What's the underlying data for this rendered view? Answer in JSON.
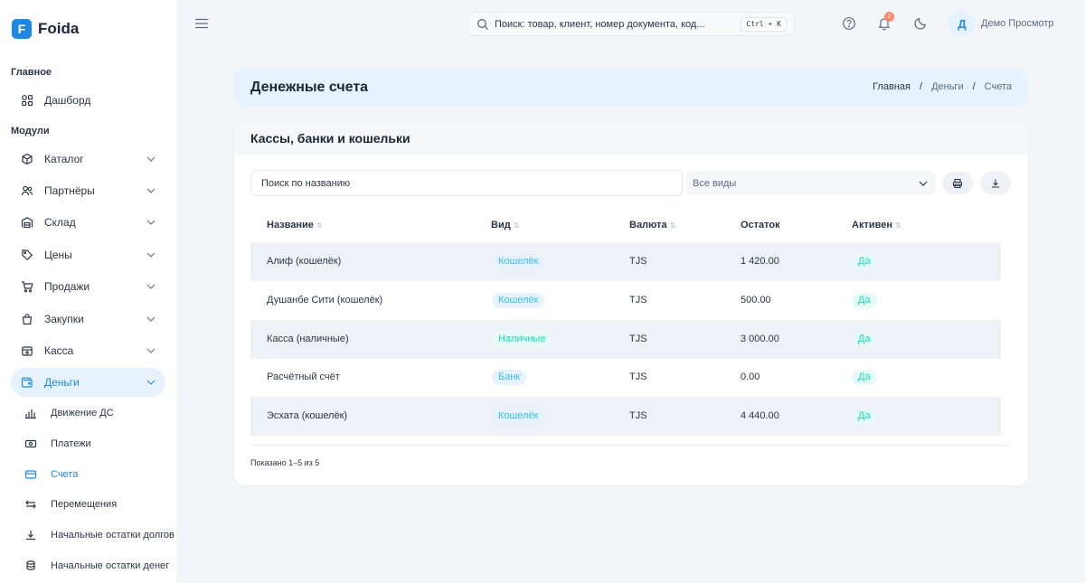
{
  "app": {
    "logo_letter": "F",
    "name": "Foida",
    "brand_color": "#1e88e5"
  },
  "sidebar": {
    "section_main": "Главное",
    "dashboard": "Дашборд",
    "section_modules": "Модули",
    "modules": [
      {
        "label": "Каталог",
        "icon": "box-icon"
      },
      {
        "label": "Партнёры",
        "icon": "users-icon"
      },
      {
        "label": "Склад",
        "icon": "warehouse-icon"
      },
      {
        "label": "Цены",
        "icon": "tag-icon"
      },
      {
        "label": "Продажи",
        "icon": "cart-icon"
      },
      {
        "label": "Закупки",
        "icon": "bag-icon"
      },
      {
        "label": "Касса",
        "icon": "cashbox-icon"
      },
      {
        "label": "Деньги",
        "icon": "wallet-icon"
      }
    ],
    "money_sub": [
      {
        "label": "Движение ДС",
        "icon": "chart-bars-icon"
      },
      {
        "label": "Платежи",
        "icon": "cash-icon"
      },
      {
        "label": "Счета",
        "icon": "card-icon"
      },
      {
        "label": "Перемещения",
        "icon": "transfer-icon"
      },
      {
        "label": "Начальные остатки долгов",
        "icon": "download-icon"
      },
      {
        "label": "Начальные остатки денег",
        "icon": "coins-icon"
      }
    ]
  },
  "topbar": {
    "search_placeholder": "Поиск: товар, клиент, номер документа, код...",
    "shortcut": "Ctrl + K",
    "notifications_count": "2",
    "avatar_letter": "Д",
    "user_name": "Демо Просмотр"
  },
  "page": {
    "title": "Денежные счета",
    "breadcrumb": [
      "Главная",
      "Деньги",
      "Счета"
    ]
  },
  "card": {
    "title": "Кассы, банки и кошельки",
    "name_search_placeholder": "Поиск по названию",
    "type_filter": "Все виды",
    "columns": [
      "Название",
      "Вид",
      "Валюта",
      "Остаток",
      "Активен"
    ],
    "rows": [
      {
        "name": "Алиф (кошелёк)",
        "type": "Кошелёк",
        "type_color": "blue",
        "currency": "TJS",
        "balance": "1 420.00",
        "active": "Да"
      },
      {
        "name": "Душанбе Сити (кошелёк)",
        "type": "Кошелёк",
        "type_color": "blue",
        "currency": "TJS",
        "balance": "500.00",
        "active": "Да"
      },
      {
        "name": "Касса (наличные)",
        "type": "Наличные",
        "type_color": "green",
        "currency": "TJS",
        "balance": "3 000.00",
        "active": "Да"
      },
      {
        "name": "Расчётный счёт",
        "type": "Банк",
        "type_color": "blue",
        "currency": "TJS",
        "balance": "0.00",
        "active": "Да"
      },
      {
        "name": "Эсхата (кошелёк)",
        "type": "Кошелёк",
        "type_color": "blue",
        "currency": "TJS",
        "balance": "4 440.00",
        "active": "Да"
      }
    ],
    "footer": "Показано 1–5 из 5"
  },
  "colors": {
    "accent": "#1e88e5",
    "success": "#13deb9",
    "info": "#38bdf8",
    "badge": "#fa896b"
  }
}
